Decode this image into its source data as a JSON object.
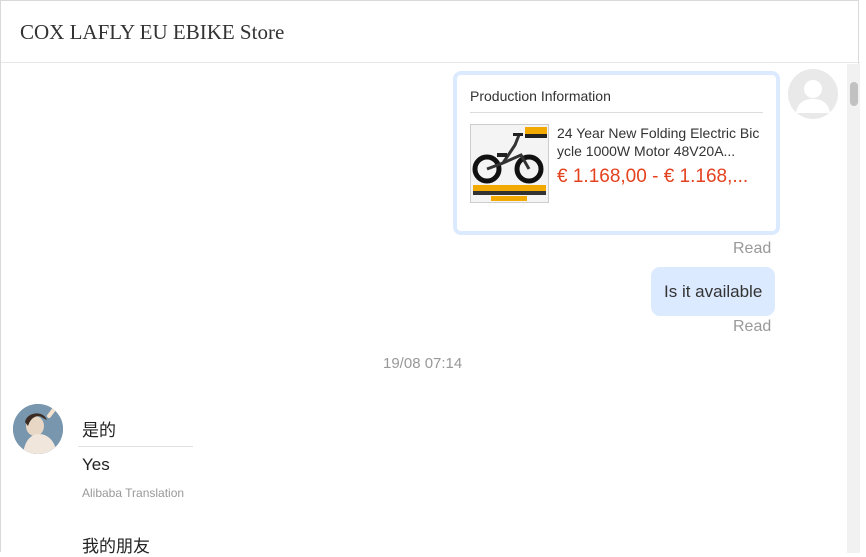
{
  "header": {
    "store_name": "COX LAFLY EU EBIKE Store"
  },
  "product_card": {
    "heading": "Production Information",
    "name": "24 Year New Folding Electric Bicycle 1000W Motor 48V20A...",
    "price": "€ 1.168,00 - € 1.168,..."
  },
  "messages": {
    "read_label_1": "Read",
    "bubble_text": "Is it available",
    "read_label_2": "Read",
    "timestamp": "19/08 07:14",
    "reply_original": "是的",
    "reply_translated": "Yes",
    "translation_credit": "Alibaba Translation",
    "next_message": "我的朋友"
  }
}
